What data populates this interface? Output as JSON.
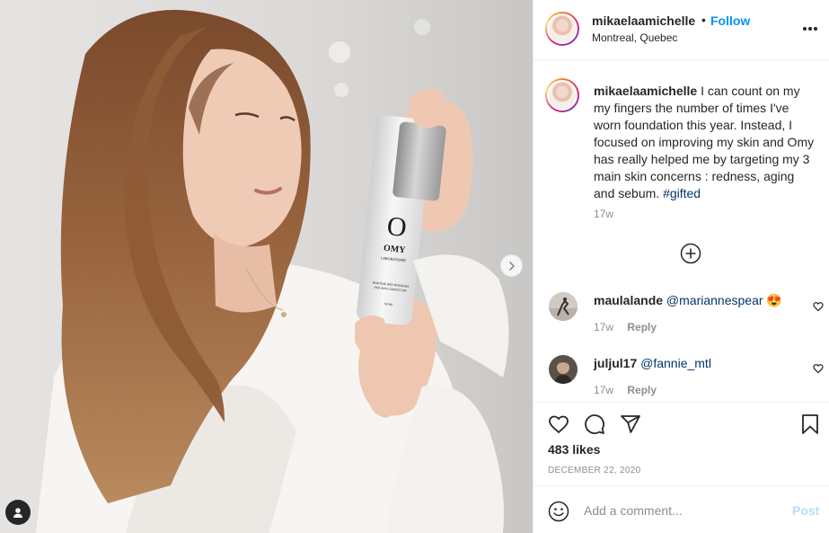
{
  "post": {
    "username": "mikaelaamichelle",
    "separator": "•",
    "follow_label": "Follow",
    "location": "Montreal, Quebec",
    "more_icon": "more-options-icon"
  },
  "product": {
    "logo_letter": "O",
    "brand": "OMY",
    "line1": "LABORATOIRE",
    "line2": "ROUTINE RED ROSACEA",
    "line3": "RED SKIN CORRECTOR",
    "line4": "50 ML"
  },
  "caption": {
    "username": "mikaelaamichelle",
    "text": "I can count on my my fingers the number of times I've worn foundation this year. Instead, I focused on improving my skin and Omy has really helped me by targeting my 3 main skin concerns : redness, aging and sebum.",
    "hashtag": "#gifted",
    "age": "17w"
  },
  "comments": [
    {
      "username": "maulalande",
      "mention": "@mariannespear",
      "emoji": "😍",
      "age": "17w",
      "reply_label": "Reply"
    },
    {
      "username": "juljul17",
      "mention": "@fannie_mtl",
      "emoji": "",
      "age": "17w",
      "reply_label": "Reply"
    }
  ],
  "actions": {
    "likes": "483 likes",
    "date": "DECEMBER 22, 2020",
    "icons": [
      "heart-icon",
      "comment-icon",
      "share-icon",
      "bookmark-icon"
    ]
  },
  "comment_box": {
    "placeholder": "Add a comment...",
    "post_label": "Post"
  },
  "colors": {
    "link_blue": "#0095f6",
    "mention_blue": "#00376b",
    "muted": "#8e8e8e",
    "post_disabled": "#b2dffc"
  }
}
